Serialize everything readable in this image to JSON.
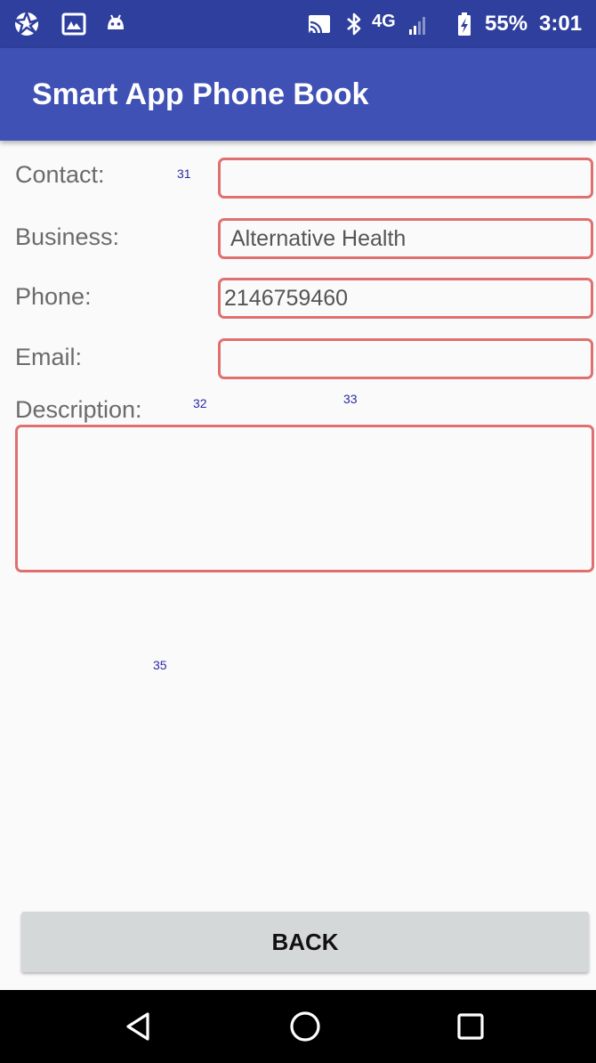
{
  "status_bar": {
    "battery_percent": "55%",
    "time": "3:01",
    "network_label": "4G",
    "icons_left": [
      "aperture-icon",
      "photo-icon",
      "android-icon"
    ],
    "icons_right": [
      "cast-icon",
      "bluetooth-icon",
      "lte-signal-icon",
      "battery-icon"
    ]
  },
  "app_bar": {
    "title": "Smart App Phone Book",
    "color": "#3f51b5"
  },
  "form": {
    "contact": {
      "label": "Contact:",
      "value": "",
      "id_tag": "31"
    },
    "business": {
      "label": "Business:",
      "value": "Alternative Health"
    },
    "phone": {
      "label": "Phone:",
      "value": "2146759460"
    },
    "email": {
      "label": "Email:",
      "value": ""
    },
    "description": {
      "label": "Description:",
      "value": "",
      "id_tag": "32"
    },
    "extra_tags": [
      "33",
      "35"
    ],
    "border_color": "#e07070"
  },
  "back_button": {
    "label": "BACK"
  },
  "nav_bar": {
    "buttons": [
      "back-triangle-icon",
      "home-circle-icon",
      "recents-square-icon"
    ]
  }
}
